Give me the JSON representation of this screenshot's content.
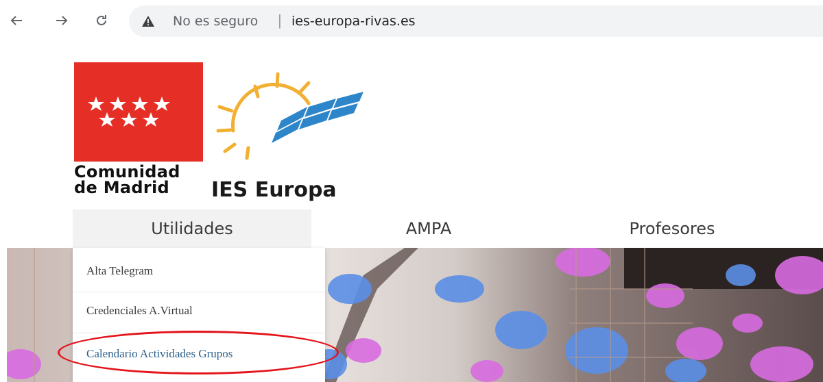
{
  "browser": {
    "back_icon": "arrow-left-icon",
    "forward_icon": "arrow-right-icon",
    "reload_icon": "reload-icon",
    "security_icon": "warning-triangle-icon",
    "security_text": "No es seguro",
    "separator": "|",
    "url": "ies-europa-rivas.es"
  },
  "logo": {
    "line1": "Comunidad",
    "line2": "de Madrid",
    "school": "IES Europa",
    "brand_red": "#e52f26"
  },
  "menu": [
    {
      "label": "Utilidades",
      "active": true
    },
    {
      "label": "AMPA",
      "active": false
    },
    {
      "label": "Profesores",
      "active": false
    }
  ],
  "dropdown": [
    {
      "label": "Alta Telegram"
    },
    {
      "label": "Credenciales A.Virtual"
    },
    {
      "label": "Calendario Actividades Grupos",
      "highlighted": true
    }
  ],
  "highlight_color": "#e4141b",
  "link_color": "#2c5f8a"
}
